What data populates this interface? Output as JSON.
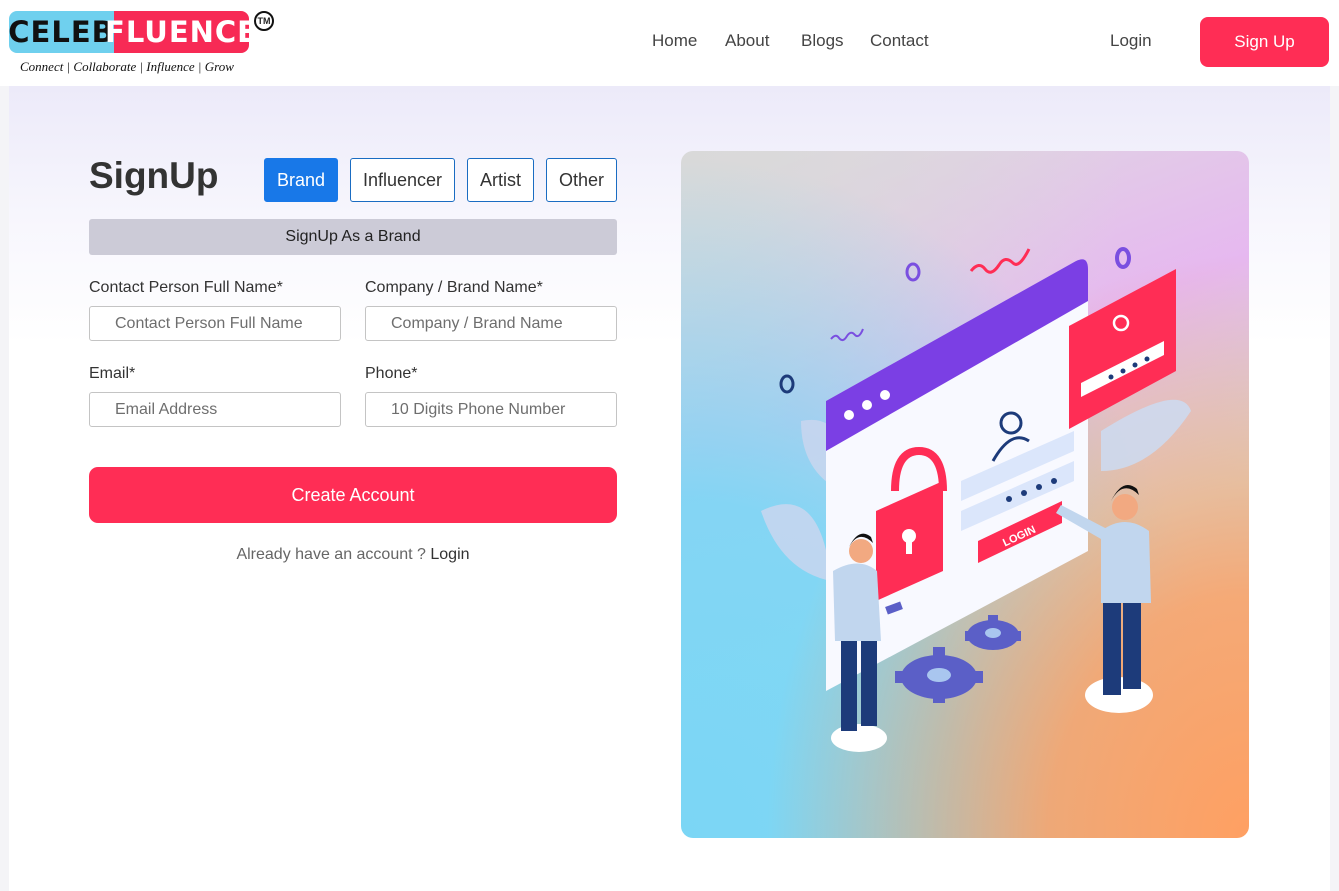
{
  "brand": {
    "logo_left": "CELEB",
    "logo_right": "FLUENCE",
    "trademark": "TM",
    "tagline": "Connect | Collaborate | Influence | Grow"
  },
  "nav": {
    "items": [
      "Home",
      "About",
      "Blogs",
      "Contact"
    ],
    "login": "Login",
    "signup": "Sign Up"
  },
  "form": {
    "title": "SignUp",
    "types": [
      "Brand",
      "Influencer",
      "Artist",
      "Other"
    ],
    "active_type": "Brand",
    "subtitle": "SignUp As a Brand",
    "fields": {
      "contact_name": {
        "label": "Contact Person Full Name*",
        "placeholder": "Contact Person Full Name"
      },
      "company": {
        "label": "Company / Brand Name*",
        "placeholder": "Company / Brand Name"
      },
      "email": {
        "label": "Email*",
        "placeholder": "Email Address"
      },
      "phone": {
        "label": "Phone*",
        "placeholder": "10 Digits Phone Number"
      }
    },
    "submit": "Create Account",
    "already_text": "Already have an account ?",
    "login_link": "Login"
  },
  "illustration": {
    "button_text": "LOGIN",
    "icon": "login-security-illustration"
  },
  "colors": {
    "accent": "#ff2d55",
    "primary": "#1878e8",
    "logo_blue": "#6fd0ee",
    "logo_pink": "#f72a55"
  }
}
